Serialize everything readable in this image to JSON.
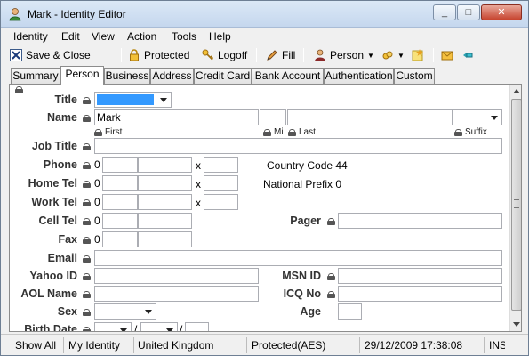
{
  "window": {
    "title": "Mark - Identity Editor",
    "min_label": "_",
    "max_label": "□",
    "close_label": "✕"
  },
  "menu": {
    "identity": "Identity",
    "edit": "Edit",
    "view": "View",
    "action": "Action",
    "tools": "Tools",
    "help": "Help"
  },
  "toolbar": {
    "save_close": "Save & Close",
    "protected": "Protected",
    "logoff": "Logoff",
    "fill": "Fill",
    "person": "Person"
  },
  "tabs": [
    "Summary",
    "Person",
    "Business",
    "Address",
    "Credit Card",
    "Bank Account",
    "Authentication",
    "Custom"
  ],
  "active_tab": "Person",
  "form": {
    "title_label": "Title",
    "name_label": "Name",
    "name_first": "Mark",
    "name_first_sub": "First",
    "name_mi_sub": "Mi",
    "name_last_sub": "Last",
    "name_suffix_sub": "Suffix",
    "job_title_label": "Job Title",
    "phone_label": "Phone",
    "home_tel_label": "Home Tel",
    "work_tel_label": "Work Tel",
    "cell_tel_label": "Cell Tel",
    "fax_label": "Fax",
    "area_prefix": "0",
    "ext_x": "x",
    "country_code_text": "Country Code 44",
    "national_prefix_text": "National Prefix 0",
    "pager_label": "Pager",
    "email_label": "Email",
    "yahoo_label": "Yahoo ID",
    "msn_label": "MSN ID",
    "aol_label": "AOL Name",
    "icq_label": "ICQ No",
    "sex_label": "Sex",
    "age_label": "Age",
    "birth_date_label": "Birth Date",
    "date_sep": "/"
  },
  "status": {
    "show_all": "Show All",
    "identity": "My Identity",
    "country": "United Kingdom",
    "protection": "Protected(AES)",
    "datetime": "29/12/2009 17:38:08",
    "ins": "INS"
  },
  "colors": {
    "title_selection": "#3399ff",
    "close_button": "#c7442f"
  }
}
